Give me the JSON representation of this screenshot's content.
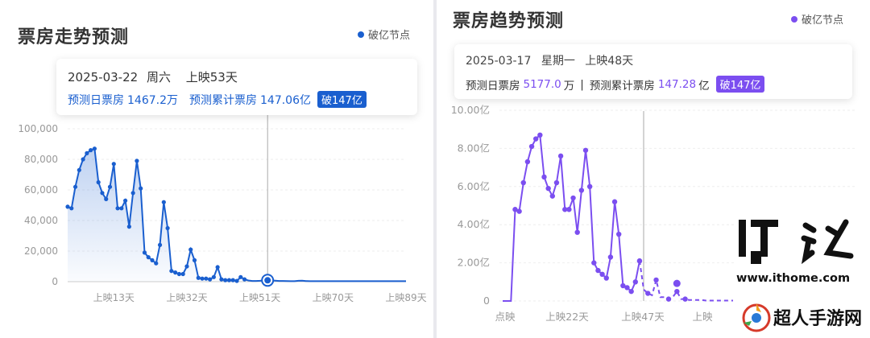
{
  "left": {
    "title": "票房走势预测",
    "legend": "破亿节点",
    "tooltip": {
      "date": "2025-03-22",
      "weekday": "周六",
      "day": "上映53天",
      "daily_label": "预测日票房",
      "daily_value": "1467.2万",
      "cum_label": "预测累计票房",
      "cum_value": "147.06亿",
      "badge": "破147亿"
    }
  },
  "right": {
    "title": "票房趋势预测",
    "legend": "破亿节点",
    "tooltip": {
      "date": "2025-03-17",
      "weekday": "星期一",
      "day": "上映48天",
      "daily_label": "预测日票房",
      "daily_value": "5177.0",
      "daily_unit": "万",
      "sep": "|",
      "cum_label": "预测累计票房",
      "cum_value": "147.28",
      "cum_unit": "亿",
      "badge": "破147亿"
    }
  },
  "watermark": {
    "logo": "IT之家",
    "url": "www.ithome.com",
    "brand": "超人手游网"
  },
  "colors": {
    "left_series": "#1a5fcf",
    "right_series": "#7b4ef0",
    "axis_text": "#999999",
    "grid": "#eeeeee"
  },
  "chart_data": [
    {
      "type": "area",
      "ylim": [
        0,
        100000
      ],
      "yticks": [
        "100,000",
        "80,000",
        "60,000",
        "40,000",
        "20,000",
        "0"
      ],
      "xticks": [
        "上映13天",
        "上映32天",
        "上映51天",
        "上映70天",
        "上映89天"
      ],
      "x_start_day": 1,
      "x_end_day": 90,
      "series": [
        {
          "values": [
            49000,
            48000,
            62000,
            73000,
            80000,
            84000,
            86000,
            87000,
            65000,
            58000,
            54000,
            62000,
            77000,
            48000,
            48000,
            53000,
            36000,
            58000,
            79000,
            61000,
            19000,
            16000,
            14000,
            12000,
            24000,
            52000,
            35000,
            7000,
            6000,
            5000,
            5000,
            10000,
            21000,
            14000,
            2500,
            2000,
            2000,
            1500,
            3000,
            9500,
            1500,
            1000,
            1000,
            1000,
            500,
            3000,
            1500,
            800,
            500,
            500,
            600,
            800,
            900,
            900,
            700,
            500,
            500,
            400,
            300,
            300,
            600,
            700,
            400,
            300,
            300,
            300,
            300,
            300,
            300,
            300,
            300,
            300,
            300,
            300,
            300,
            300,
            300,
            300,
            300,
            300,
            300,
            300,
            300,
            300,
            300,
            300,
            300,
            300,
            300
          ]
        }
      ]
    },
    {
      "type": "line",
      "ylim": [
        0,
        10
      ],
      "yticks": [
        "10.00亿",
        "8.00亿",
        "6.00亿",
        "4.00亿",
        "2.00亿",
        "0"
      ],
      "xticks": [
        "点映",
        "上映22天",
        "上映47天",
        "上映"
      ],
      "series": [
        {
          "solid_values": [
            0,
            0,
            0,
            4.8,
            4.7,
            6.2,
            7.3,
            8.1,
            8.5,
            8.7,
            6.5,
            5.9,
            5.5,
            6.2,
            7.6,
            4.8,
            4.8,
            5.4,
            3.6,
            5.8,
            7.9,
            6.0,
            2.0,
            1.6,
            1.4,
            1.2,
            2.3,
            5.2,
            3.5,
            0.8,
            0.7,
            0.5,
            1.0,
            2.1
          ],
          "dashed_values": [
            2.1,
            0.6,
            0.4,
            0.3,
            1.1,
            0.2,
            0.2,
            0.1,
            0.2,
            0.5,
            0.1,
            0.1,
            0.05,
            0.05,
            0.05,
            0.05,
            0.02,
            0.02,
            0.02,
            0.02,
            0.02,
            0.02,
            0.02,
            0.02,
            0.02,
            0.02,
            0.02
          ]
        }
      ]
    }
  ]
}
